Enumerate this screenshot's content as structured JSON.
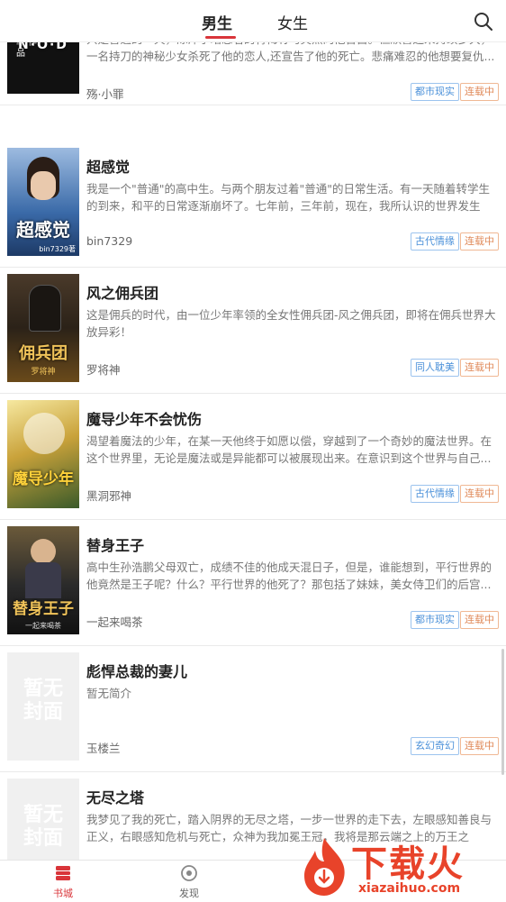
{
  "header": {
    "tabs": [
      {
        "label": "男生",
        "active": true
      },
      {
        "label": "女生",
        "active": false
      }
    ],
    "search_icon": "search-icon"
  },
  "books": [
    {
      "title": "",
      "desc": "只是普通的一天，陈泽宇暗恋着的青梅竹马突然向他告白。但欣喜还未持续多久，一名持刀的神秘少女杀死了他的恋人,还宣告了他的死亡。悲痛难忍的他想要复仇...",
      "author": "殇·小罪",
      "genre": "都市现实",
      "status": "连载中",
      "cover_text": "N·O·D",
      "cover_sub": "殇·小罪 作品",
      "cover_color": "#111111"
    },
    {
      "title": "超感觉",
      "desc": "我是一个\"普通\"的高中生。与两个朋友过着\"普通\"的日常生活。有一天随着转学生的到来，和平的日常逐渐崩坏了。七年前，三年前，现在，我所认识的世界发生了...",
      "author": "bin7329",
      "genre": "古代情缘",
      "status": "连载中",
      "cover_text": "超感觉",
      "cover_sub": "bin7329著",
      "cover_color": "#3a6aa8"
    },
    {
      "title": "风之佣兵团",
      "desc": "这是佣兵的时代，由一位少年率领的全女性佣兵团-风之佣兵团，即将在佣兵世界大放异彩！",
      "author": "罗将神",
      "genre": "同人耽美",
      "status": "连载中",
      "cover_text": "佣兵团",
      "cover_sub": "罗将神",
      "cover_color": "#2b2218"
    },
    {
      "title": "魔导少年不会忧伤",
      "desc": "渴望着魔法的少年，在某一天他终于如愿以偿，穿越到了一个奇妙的魔法世界。在这个世界里，无论是魔法或是异能都可以被展现出来。在意识到这个世界与自己...",
      "author": "黑洞邪神",
      "genre": "古代情缘",
      "status": "连载中",
      "cover_text": "魔导少年",
      "cover_sub": "",
      "cover_color": "#c9a23a"
    },
    {
      "title": "替身王子",
      "desc": "高中生孙浩鹏父母双亡，成绩不佳的他成天混日子，但是，谁能想到，平行世界的他竟然是王子呢？什么？平行世界的他死了？那包括了妹妹，美女侍卫们的后宫...",
      "author": "一起来喝茶",
      "genre": "都市现实",
      "status": "连载中",
      "cover_text": "替身王子",
      "cover_sub": "一起来喝茶",
      "cover_color": "#2a2a2a"
    },
    {
      "title": "彪悍总裁的妻儿",
      "desc": "暂无简介",
      "author": "玉楼兰",
      "genre": "玄幻奇幻",
      "status": "连载中",
      "cover_text": "暂无封面",
      "cover_sub": "",
      "cover_color": "#f0f0f0"
    },
    {
      "title": "无尽之塔",
      "desc": "我梦见了我的死亡，踏入阴界的无尽之塔，一步一世界的走下去，左眼感知善良与正义，右眼感知危机与死亡，众神为我加冕王冠，我将是那云端之上的万王之王！...",
      "author": "",
      "genre": "",
      "status": "",
      "cover_text": "暂无封面",
      "cover_sub": "",
      "cover_color": "#f0f0f0"
    }
  ],
  "bottom_nav": [
    {
      "label": "书城",
      "active": true
    },
    {
      "label": "发现",
      "active": false
    }
  ],
  "watermark": {
    "big": "下载火",
    "small": "xiazaihuo.com"
  },
  "colors": {
    "accent": "#d9353a",
    "genre_tag": "#4a90d9",
    "status_tag": "#e08a5a"
  }
}
